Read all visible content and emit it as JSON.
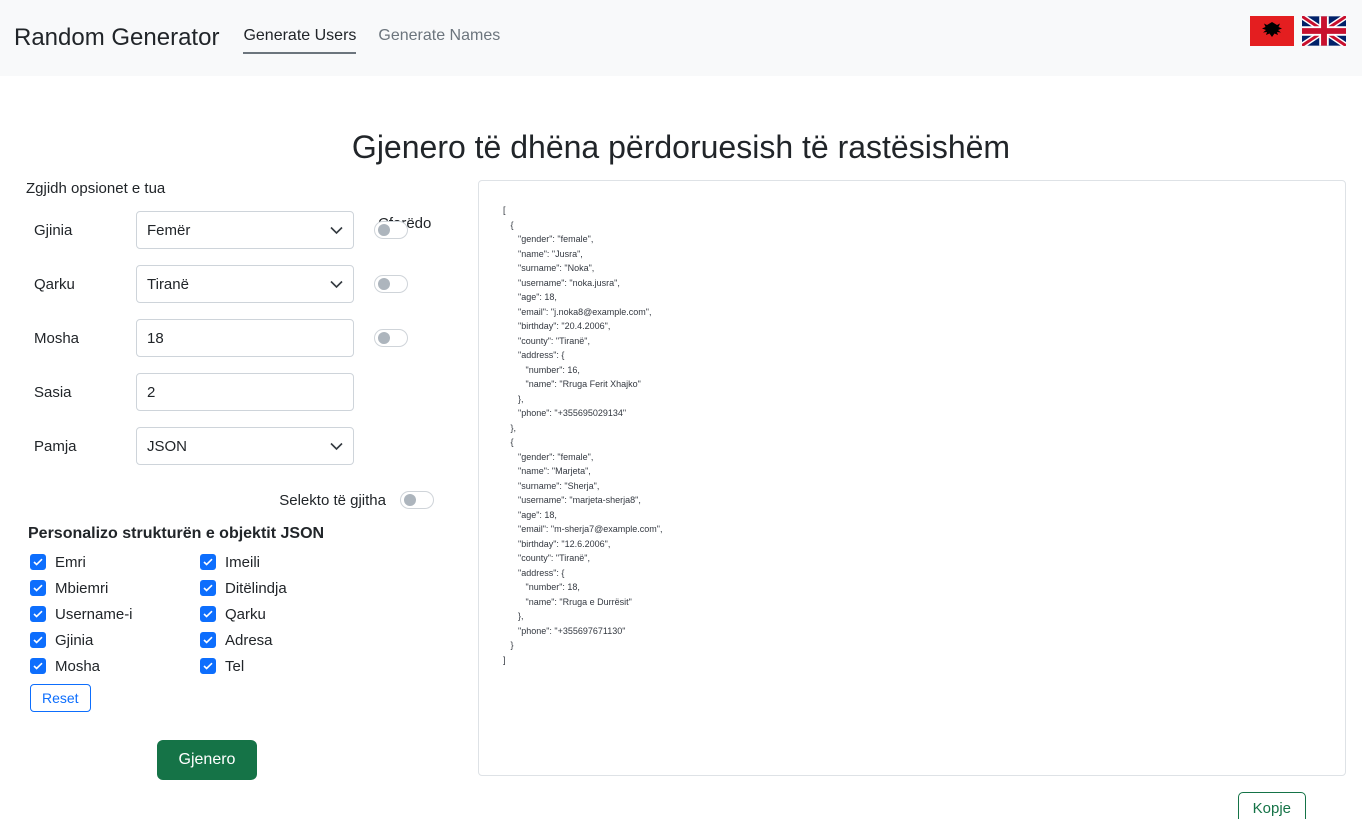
{
  "header": {
    "brand": "Random Generator",
    "tabs": [
      {
        "label": "Generate Users",
        "active": true
      },
      {
        "label": "Generate Names",
        "active": false
      }
    ],
    "flags": [
      {
        "name": "albania-flag",
        "alt": "Shqip"
      },
      {
        "name": "uk-flag",
        "alt": "English"
      }
    ]
  },
  "page": {
    "title": "Gjenero të dhëna përdoruesish të rastësishëm"
  },
  "options": {
    "section_label": "Zgjidh opsionet e tua",
    "anything_header": "Çfarëdo",
    "rows": [
      {
        "label": "Gjinia",
        "value": "Femër",
        "type": "select",
        "toggle": true,
        "toggle_on": false
      },
      {
        "label": "Qarku",
        "value": "Tiranë",
        "type": "select",
        "toggle": true,
        "toggle_on": false
      },
      {
        "label": "Mosha",
        "value": "18",
        "type": "input",
        "toggle": true,
        "toggle_on": false
      },
      {
        "label": "Sasia",
        "value": "2",
        "type": "input",
        "toggle": false,
        "toggle_on": false
      },
      {
        "label": "Pamja",
        "value": "JSON",
        "type": "select",
        "toggle": false,
        "toggle_on": false
      }
    ],
    "select_all_label": "Selekto të gjitha",
    "select_all_on": false
  },
  "customize": {
    "heading": "Personalizo strukturën e objektit JSON",
    "checkboxes": [
      {
        "label": "Emri",
        "checked": true
      },
      {
        "label": "Imeili",
        "checked": true
      },
      {
        "label": "Mbiemri",
        "checked": true
      },
      {
        "label": "Ditëlindja",
        "checked": true
      },
      {
        "label": "Username-i",
        "checked": true
      },
      {
        "label": "Qarku",
        "checked": true
      },
      {
        "label": "Gjinia",
        "checked": true
      },
      {
        "label": "Adresa",
        "checked": true
      },
      {
        "label": "Mosha",
        "checked": true
      },
      {
        "label": "Tel",
        "checked": true
      }
    ],
    "reset_label": "Reset"
  },
  "actions": {
    "generate_label": "Gjenero",
    "copy_label": "Kopje"
  },
  "output": {
    "text": "[\n   {\n      \"gender\": \"female\",\n      \"name\": \"Jusra\",\n      \"surname\": \"Noka\",\n      \"username\": \"noka.jusra\",\n      \"age\": 18,\n      \"email\": \"j.noka8@example.com\",\n      \"birthday\": \"20.4.2006\",\n      \"county\": \"Tiranë\",\n      \"address\": {\n         \"number\": 16,\n         \"name\": \"Rruga Ferit Xhajko\"\n      },\n      \"phone\": \"+355695029134\"\n   },\n   {\n      \"gender\": \"female\",\n      \"name\": \"Marjeta\",\n      \"surname\": \"Sherja\",\n      \"username\": \"marjeta-sherja8\",\n      \"age\": 18,\n      \"email\": \"m-sherja7@example.com\",\n      \"birthday\": \"12.6.2006\",\n      \"county\": \"Tiranë\",\n      \"address\": {\n         \"number\": 18,\n         \"name\": \"Rruga e Durrësit\"\n      },\n      \"phone\": \"+355697671130\"\n   }\n]"
  },
  "colors": {
    "accent_green": "#157347",
    "accent_blue": "#0d6efd",
    "header_bg": "#f8f9fa"
  }
}
